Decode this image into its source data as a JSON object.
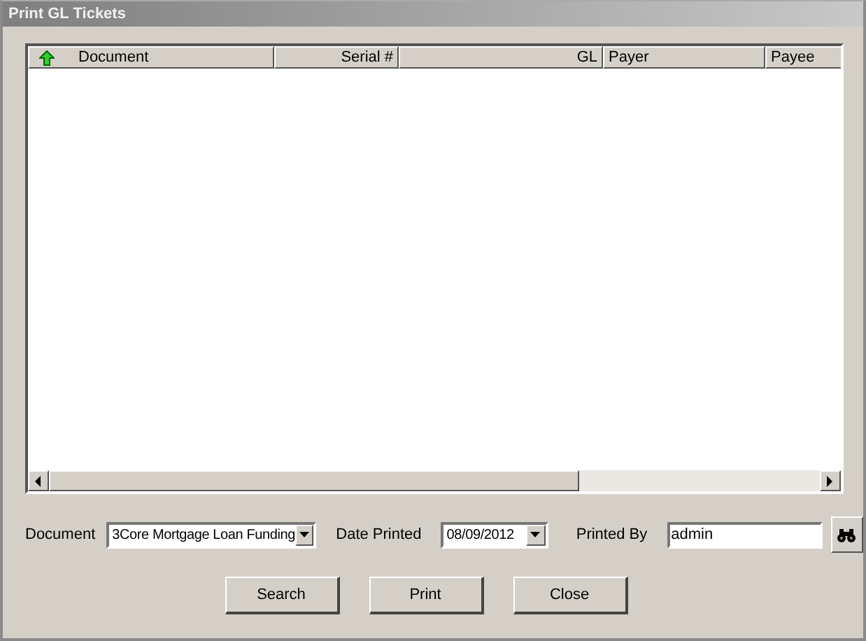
{
  "window": {
    "title": "Print GL Tickets"
  },
  "table": {
    "columns": [
      {
        "label": "Document",
        "sorted": true
      },
      {
        "label": "Serial #",
        "sorted": false
      },
      {
        "label": "GL",
        "sorted": false
      },
      {
        "label": "Payer",
        "sorted": false
      },
      {
        "label": "Payee",
        "sorted": false
      }
    ]
  },
  "filters": {
    "document": {
      "label": "Document",
      "value": "3Core Mortgage Loan Funding"
    },
    "date_printed": {
      "label": "Date Printed",
      "value": "08/09/2012"
    },
    "printed_by": {
      "label": "Printed By",
      "value": "admin"
    }
  },
  "buttons": [
    "Search",
    "Print",
    "Close"
  ]
}
